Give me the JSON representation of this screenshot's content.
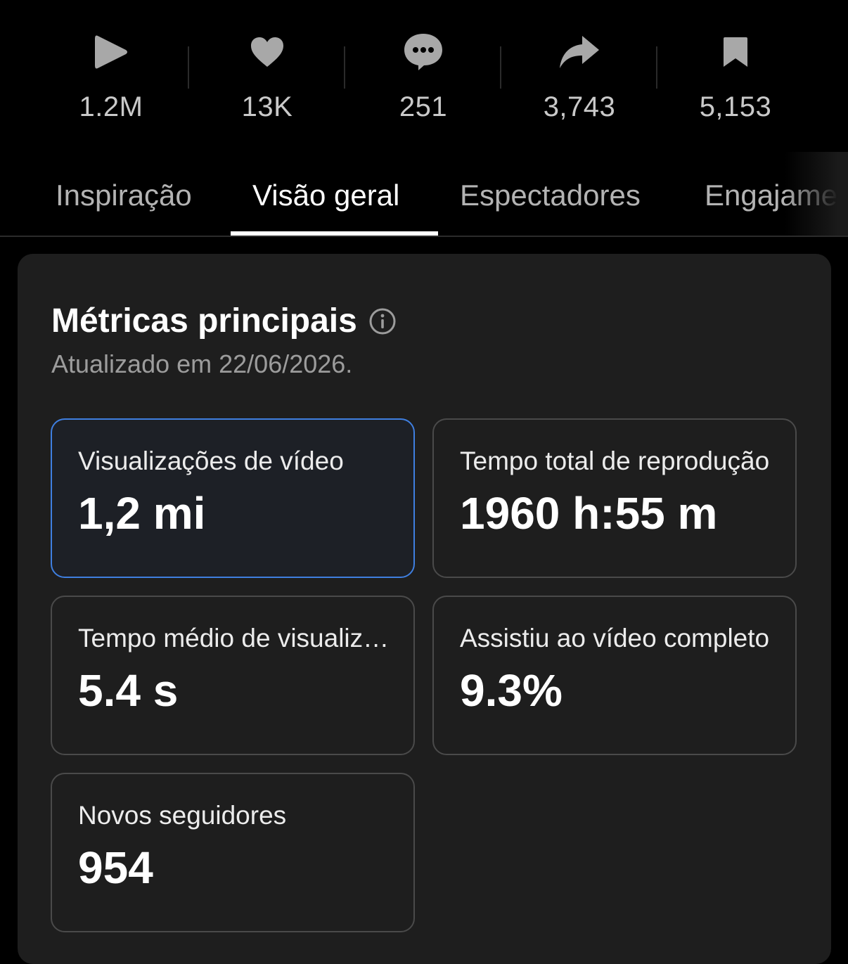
{
  "stats": [
    {
      "icon": "play-icon",
      "count": "1.2M"
    },
    {
      "icon": "heart-icon",
      "count": "13K"
    },
    {
      "icon": "comment-icon",
      "count": "251"
    },
    {
      "icon": "share-icon",
      "count": "3,743"
    },
    {
      "icon": "bookmark-icon",
      "count": "5,153"
    }
  ],
  "tabs": [
    {
      "label": "Inspiração",
      "active": false
    },
    {
      "label": "Visão geral",
      "active": true
    },
    {
      "label": "Espectadores",
      "active": false
    },
    {
      "label": "Engajamento",
      "active": false
    }
  ],
  "card": {
    "title": "Métricas principais",
    "subtitle": "Atualizado em 22/06/2026."
  },
  "metrics": [
    {
      "label": "Visualizações de vídeo",
      "value": "1,2 mi",
      "selected": true
    },
    {
      "label": "Tempo total de reprodução",
      "value": "1960 h:55 m",
      "selected": false
    },
    {
      "label": "Tempo médio de visualização",
      "value": "5.4 s",
      "selected": false
    },
    {
      "label": "Assistiu ao vídeo completo",
      "value": "9.3%",
      "selected": false
    },
    {
      "label": "Novos seguidores",
      "value": "954",
      "selected": false
    }
  ],
  "colors": {
    "background": "#000000",
    "card": "#1e1e1e",
    "selected_border": "#3f7fe0",
    "icon": "#a8a8a8"
  }
}
